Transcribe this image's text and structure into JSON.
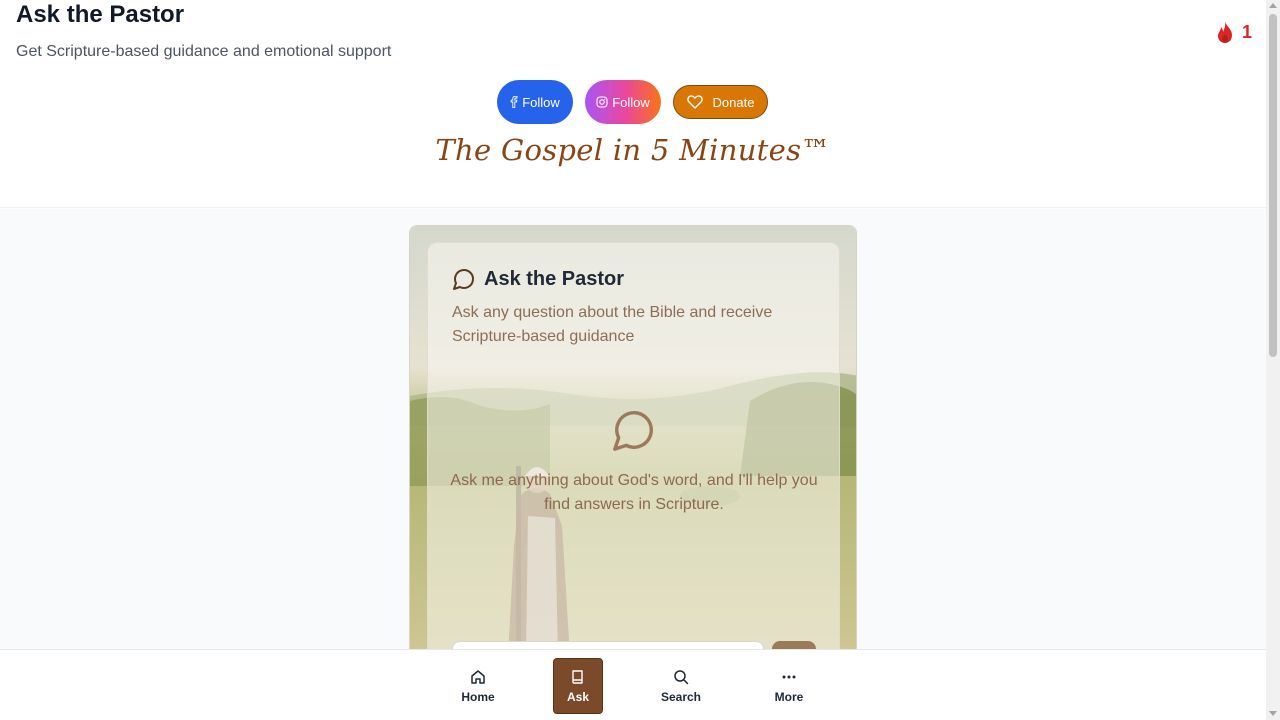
{
  "header": {
    "title": "Ask the Pastor",
    "subtitle": "Get Scripture-based guidance and emotional support",
    "streak": {
      "icon": "flame-icon",
      "count": "1"
    }
  },
  "social": {
    "facebook_label": "Follow",
    "instagram_label": "Follow",
    "donate_label": "Donate"
  },
  "brand": {
    "tagline": "The Gospel in 5 Minutes™"
  },
  "card": {
    "title": "Ask the Pastor",
    "description": "Ask any question about the Bible and receive Scripture-based guidance",
    "empty_state": "Ask me anything about God's word, and I'll help you find answers in Scripture.",
    "input_placeholder": ""
  },
  "nav": {
    "items": [
      {
        "label": "Home",
        "icon": "home-icon",
        "active": false
      },
      {
        "label": "Ask",
        "icon": "book-icon",
        "active": true
      },
      {
        "label": "Search",
        "icon": "search-icon",
        "active": false
      },
      {
        "label": "More",
        "icon": "more-icon",
        "active": false
      }
    ]
  },
  "colors": {
    "accent_brown": "#7a4a2a",
    "facebook": "#2563eb",
    "donate": "#d97706",
    "streak": "#dc2626"
  }
}
